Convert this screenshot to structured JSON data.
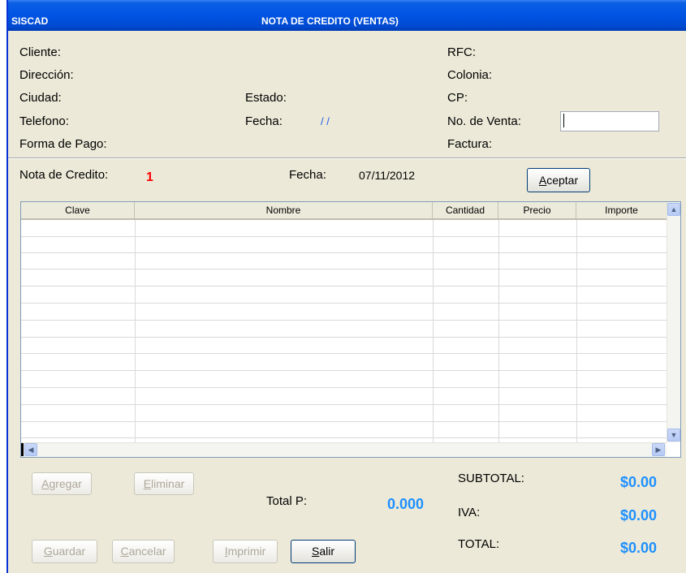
{
  "window": {
    "app_title": "SISCAD",
    "form_title": "NOTA DE CREDITO (VENTAS)"
  },
  "header_fields": {
    "cliente": "Cliente:",
    "direccion": "Dirección:",
    "ciudad": "Ciudad:",
    "telefono": "Telefono:",
    "forma_pago": "Forma de Pago:",
    "estado": "Estado:",
    "fecha": "Fecha:",
    "fecha_value": "/ /",
    "rfc": "RFC:",
    "colonia": "Colonia:",
    "cp": "CP:",
    "no_venta": "No. de Venta:",
    "no_venta_value": "",
    "factura": "Factura:"
  },
  "nota": {
    "label": "Nota de Credito:",
    "number": "1",
    "fecha_label": "Fecha:",
    "fecha_value": "07/11/2012",
    "aceptar": "Aceptar",
    "aceptar_key": "A",
    "aceptar_rest": "ceptar"
  },
  "grid": {
    "columns": [
      "Clave",
      "Nombre",
      "Cantidad",
      "Precio",
      "Importe"
    ],
    "rows": []
  },
  "buttons": {
    "agregar": {
      "key": "A",
      "rest": "gregar"
    },
    "eliminar": {
      "key": "E",
      "rest": "liminar"
    },
    "guardar": {
      "key": "G",
      "rest": "uardar"
    },
    "cancelar": {
      "key": "C",
      "rest": "ancelar"
    },
    "imprimir": {
      "key": "I",
      "rest": "mprimir"
    },
    "salir": {
      "key": "S",
      "rest": "alir"
    }
  },
  "totals": {
    "total_p_label": "Total P:",
    "total_p_value": "0.000",
    "subtotal_label": "SUBTOTAL:",
    "subtotal_value": "$0.00",
    "iva_label": "IVA:",
    "iva_value": "$0.00",
    "total_label": "TOTAL:",
    "total_value": "$0.00"
  },
  "colors": {
    "accent_value": "#1e90ff",
    "nota_number": "#ff0000",
    "titlebar": "#0054e3"
  }
}
